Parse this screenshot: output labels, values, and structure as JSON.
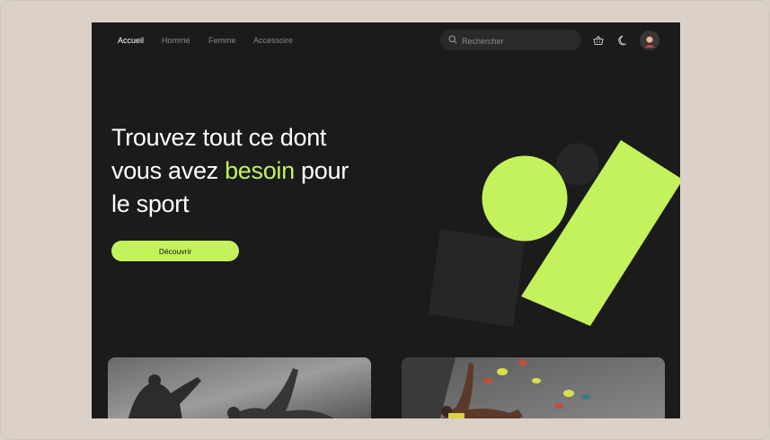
{
  "nav": {
    "links": [
      "Accueil",
      "Homme",
      "Femme",
      "Accessoire"
    ],
    "active": "Accueil",
    "search_placeholder": "Rechercher"
  },
  "icons": {
    "search": "search-icon",
    "cart": "basket-icon",
    "theme": "moon-icon",
    "profile": "avatar"
  },
  "hero": {
    "title_line1": "Trouvez tout ce dont",
    "title_line2_before": "vous avez ",
    "title_line2_accent": "besoin",
    "title_line2_after": " pour",
    "title_line3": "le sport",
    "cta_label": "Découvrir"
  },
  "colors": {
    "accent": "#c4f25c",
    "background": "#1b1b1b",
    "outer": "#dbd1c9"
  },
  "cards": [
    {
      "name": "athletes-photo-card"
    },
    {
      "name": "climbing-photo-card"
    }
  ]
}
